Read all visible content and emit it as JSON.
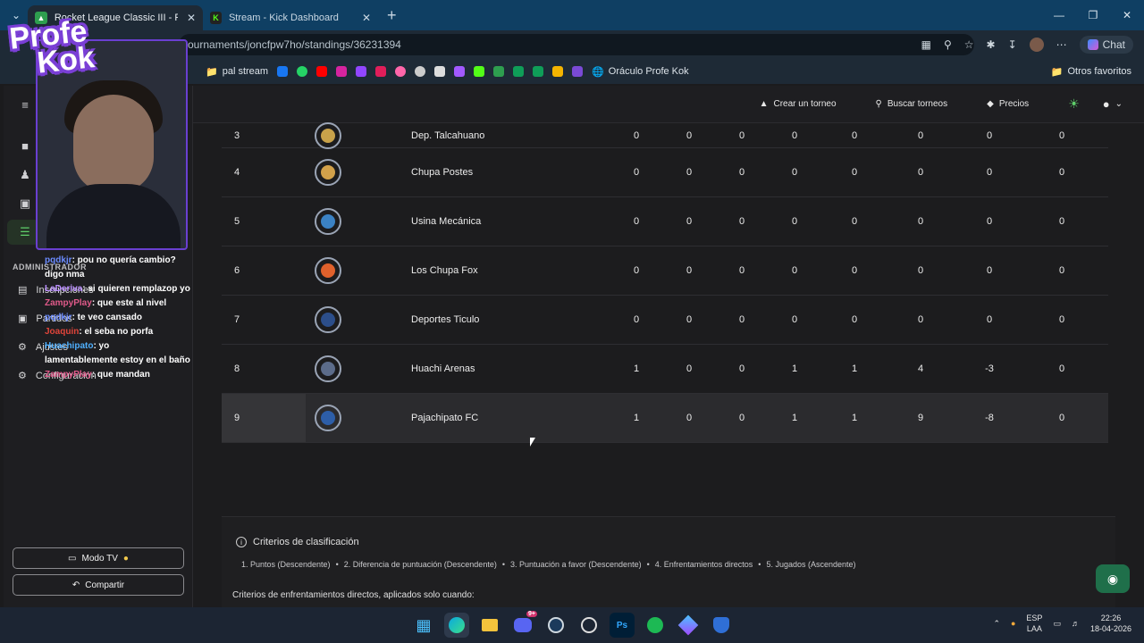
{
  "browser": {
    "tabs": [
      {
        "title": "Rocket League Classic III - Partidos",
        "active": true,
        "favicon_color": "#2e9e4f"
      },
      {
        "title": "Stream - Kick Dashboard",
        "active": false,
        "favicon_color": "#53fc18"
      }
    ],
    "url": "ournaments/joncfpw7ho/standings/36231394",
    "chat_label": "Chat",
    "bookmarks": {
      "first": "pal stream",
      "oracle": "Oráculo Profe Kok",
      "others": "Otros favoritos"
    }
  },
  "topbar": {
    "create": "Crear un torneo",
    "search": "Buscar torneos",
    "prices": "Precios"
  },
  "sidebar": {
    "admin_label": "ADMINISTRADOR",
    "items": [
      "Inscripciones",
      "Partidos",
      "Ajustes",
      "Configuración"
    ],
    "tv_button": "Modo TV",
    "share_button": "Compartir"
  },
  "standings": {
    "rows": [
      {
        "pos": "3",
        "team": "Dep. Talcahuano",
        "vals": [
          "0",
          "0",
          "0",
          "0",
          "0",
          "0",
          "0",
          "0"
        ],
        "logo_color": "#c8a24a"
      },
      {
        "pos": "4",
        "team": "Chupa Postes",
        "vals": [
          "0",
          "0",
          "0",
          "0",
          "0",
          "0",
          "0",
          "0"
        ],
        "logo_color": "#d2a14a"
      },
      {
        "pos": "5",
        "team": "Usina Mecánica",
        "vals": [
          "0",
          "0",
          "0",
          "0",
          "0",
          "0",
          "0",
          "0"
        ],
        "logo_color": "#3b82c4"
      },
      {
        "pos": "6",
        "team": "Los Chupa Fox",
        "vals": [
          "0",
          "0",
          "0",
          "0",
          "0",
          "0",
          "0",
          "0"
        ],
        "logo_color": "#e0612c"
      },
      {
        "pos": "7",
        "team": "Deportes Ticulo",
        "vals": [
          "0",
          "0",
          "0",
          "0",
          "0",
          "0",
          "0",
          "0"
        ],
        "logo_color": "#2c4e8a"
      },
      {
        "pos": "8",
        "team": "Huachi Arenas",
        "vals": [
          "1",
          "0",
          "0",
          "1",
          "1",
          "4",
          "-3",
          "0"
        ],
        "logo_color": "#5c6c8a"
      },
      {
        "pos": "9",
        "team": "Pajachipato FC",
        "vals": [
          "1",
          "0",
          "0",
          "1",
          "1",
          "9",
          "-8",
          "0"
        ],
        "logo_color": "#2d5ea8",
        "highlighted": true
      }
    ]
  },
  "criteria": {
    "title": "Criterios de clasificación",
    "items": [
      "1. Puntos (Descendente)",
      "2. Diferencia de puntuación (Descendente)",
      "3. Puntuación a favor (Descendente)",
      "4. Enfrentamientos directos",
      "5. Jugados (Ascendente)"
    ],
    "subtitle": "Criterios de enfrentamientos directos, aplicados solo cuando:"
  },
  "overlay": {
    "brand_line1": "Profe",
    "brand_line2": "Kok",
    "chat": [
      {
        "user": "pqdkjr",
        "color": "#6c8cff",
        "msg": ": pou no quería cambio? digo nma"
      },
      {
        "user": "LaDeriva",
        "color": "#b98cff",
        "msg": ": si quieren remplazop yo"
      },
      {
        "user": "ZampyPlay",
        "color": "#e05a8a",
        "msg": ": que este al nivel"
      },
      {
        "user": "pqdkjr",
        "color": "#6c8cff",
        "msg": ": te veo cansado"
      },
      {
        "user": "Joaquin",
        "color": "#e0443a",
        "msg": ": el seba no porfa"
      },
      {
        "user": "Huachipato",
        "color": "#4fb0ff",
        "msg": ": yo"
      },
      {
        "user": "lamentablemente",
        "color": "#ffffff",
        "msg": " estoy en el baño"
      },
      {
        "user": "ZampyPlay",
        "color": "#e05a8a",
        "msg": ": que mandan"
      }
    ]
  },
  "taskbar": {
    "discord_badge": "9+",
    "lang_top": "ESP",
    "lang_bottom": "LAA",
    "time": "22:26",
    "date": "18-04-2026"
  }
}
